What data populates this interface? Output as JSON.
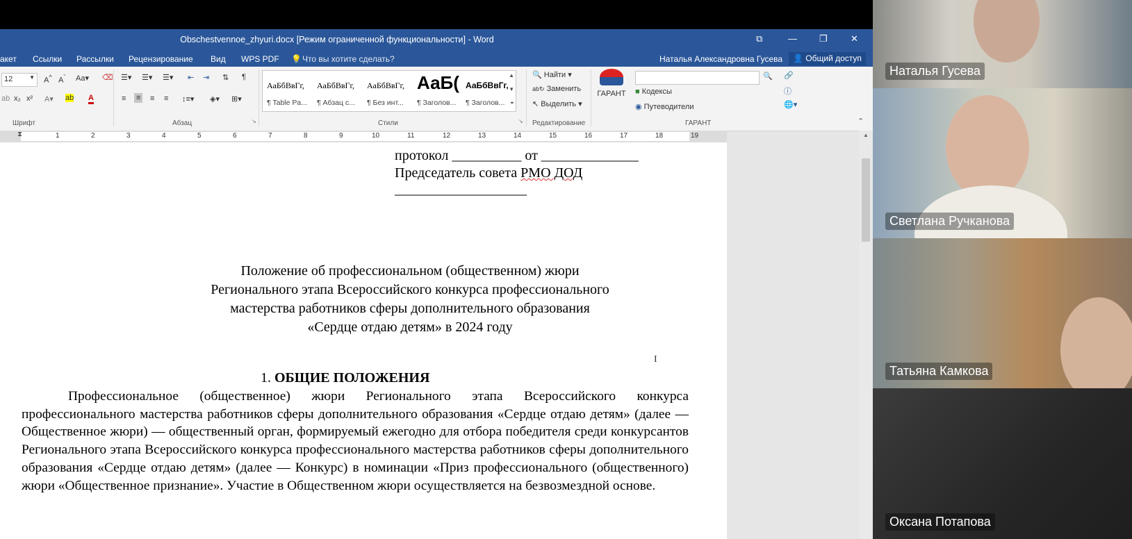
{
  "window": {
    "title": "Obschestvennoe_zhyuri.docx [Режим ограниченной функциональности] - Word",
    "controls": [
      "⧉",
      "—",
      "❐",
      "✕"
    ]
  },
  "menu": {
    "items": [
      "акет",
      "Ссылки",
      "Рассылки",
      "Рецензирование",
      "Вид",
      "WPS PDF"
    ],
    "tell_me": "Что вы хотите сделать?",
    "user": "Наталья Александровна Гусева",
    "share": "Общий доступ"
  },
  "ribbon": {
    "font_size": "12",
    "groups": {
      "font": "Шрифт",
      "paragraph": "Абзац",
      "styles": "Стили",
      "editing": "Редактирование",
      "garant": "ГАРАНТ"
    },
    "styles": [
      {
        "preview": "АаБбВвГг,",
        "name": "¶ Table Pa..."
      },
      {
        "preview": "АаБбВвГг,",
        "name": "¶ Абзац с..."
      },
      {
        "preview": "АаБбВвГг,",
        "name": "¶ Без инт..."
      },
      {
        "preview": "АаБ(",
        "name": "¶ Заголов..."
      },
      {
        "preview": "АаБбВвГг,",
        "name": "¶ Заголов..."
      }
    ],
    "editing": {
      "find": "Найти",
      "replace": "Заменить",
      "select": "Выделить"
    },
    "garant": {
      "button": "ГАРАНТ",
      "codes": "Кодексы",
      "guides": "Путеводители"
    }
  },
  "ruler": {
    "numbers": [
      "1",
      "2",
      "3",
      "4",
      "5",
      "6",
      "7",
      "8",
      "9",
      "10",
      "11",
      "12",
      "13",
      "14",
      "15",
      "16",
      "17",
      "18",
      "19"
    ]
  },
  "document": {
    "header_lines": [
      "протокол __________ от ______________",
      "Председатель совета РМО ДОД",
      "___________________"
    ],
    "title_lines": [
      "Положение об профессиональном (общественном) жюри",
      "Регионального этапа Всероссийского конкурса профессионального",
      "мастерства работников сферы дополнительного образования",
      "«Сердце отдаю детям» в 2024 году"
    ],
    "section_number": "1.",
    "section_title": "ОБЩИЕ ПОЛОЖЕНИЯ",
    "paragraph": "Профессиональное (общественное) жюри Регионального этапа Всероссийского конкурса профессионального мастерства работников сферы дополнительного образования «Сердце отдаю детям» (далее — Общественное жюри) — общественный орган, формируемый ежегодно для отбора победителя среди конкурсантов Регионального этапа Всероссийского конкурса профессионального мастерства работников сферы дополнительного образования «Сердце отдаю детям» (далее — Конкурс) в номинации «Приз профессионального (общественного) жюри «Общественное признание». Участие в Общественном жюри осуществляется на безвозмездной основе."
  },
  "participants": [
    {
      "name": "Наталья Гусева"
    },
    {
      "name": "Светлана Ручканова"
    },
    {
      "name": "Татьяна Камкова"
    },
    {
      "name": "Оксана Потапова"
    }
  ],
  "colors": {
    "word_blue": "#2b579a"
  }
}
